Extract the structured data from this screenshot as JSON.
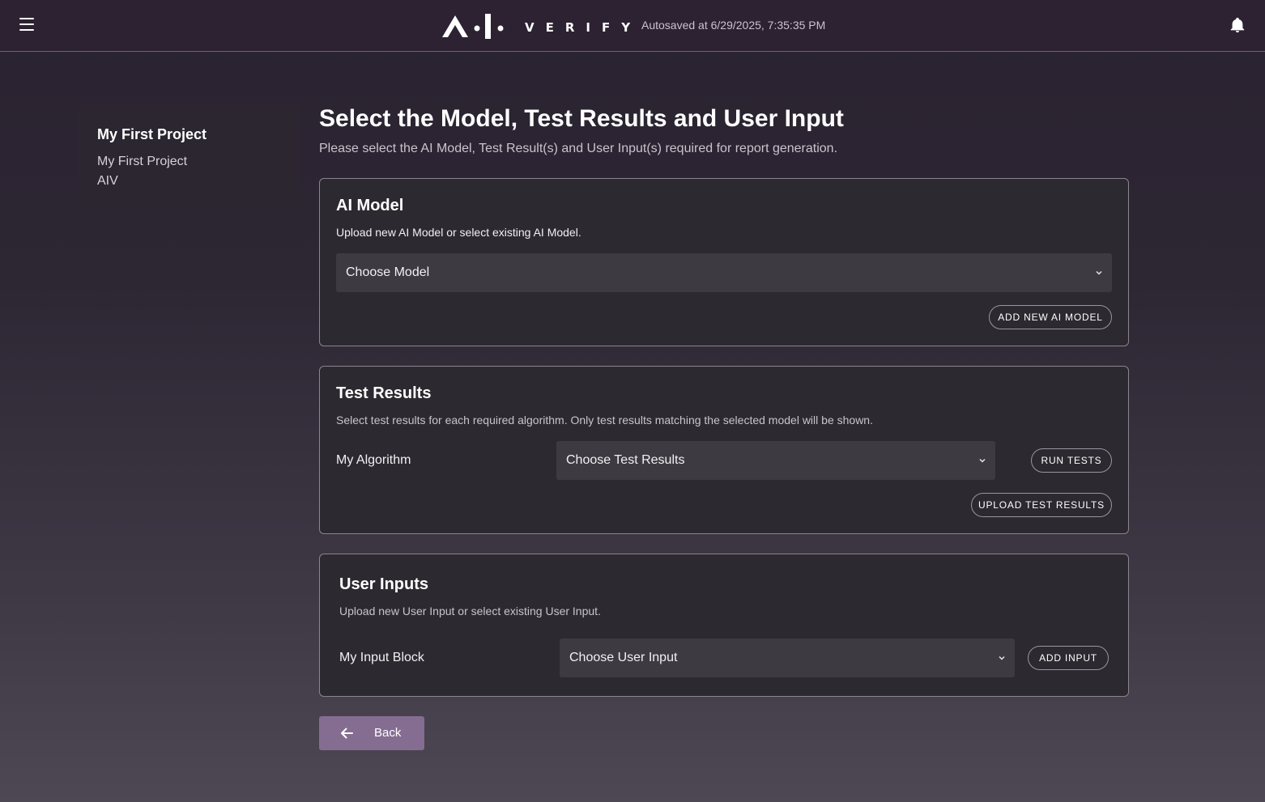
{
  "header": {
    "logo_text": "VERIFY",
    "autosave": "Autosaved at 6/29/2025, 7:35:35 PM"
  },
  "sidebar": {
    "title": "My First Project",
    "lines": [
      "My First Project",
      "AIV"
    ]
  },
  "main": {
    "title": "Select the Model, Test Results and User Input",
    "subtitle": "Please select the AI Model, Test Result(s) and User Input(s) required for report generation."
  },
  "ai_model": {
    "title": "AI Model",
    "description": "Upload new AI Model or select existing AI Model.",
    "select_placeholder": "Choose Model",
    "add_button": "ADD NEW AI MODEL"
  },
  "test_results": {
    "title": "Test Results",
    "description": "Select test results for each required algorithm. Only test results matching the selected model will be shown.",
    "row_label": "My Algorithm",
    "select_placeholder": "Choose Test Results",
    "run_button": "RUN TESTS",
    "upload_button": "UPLOAD TEST RESULTS"
  },
  "user_inputs": {
    "title": "User Inputs",
    "description": "Upload new User Input or select existing User Input.",
    "row_label": "My Input Block",
    "select_placeholder": "Choose User Input",
    "add_button": "ADD INPUT"
  },
  "footer": {
    "back_label": "Back"
  },
  "icons": {
    "menu": "hamburger-menu-icon",
    "bell": "bell-icon",
    "chevron": "chevron-down-icon",
    "back": "arrow-left-icon"
  },
  "colors": {
    "header_bg": "#2c2232",
    "card_bg": "#2d2930",
    "select_bg": "#3d3a41",
    "accent_button": "#856d92"
  }
}
